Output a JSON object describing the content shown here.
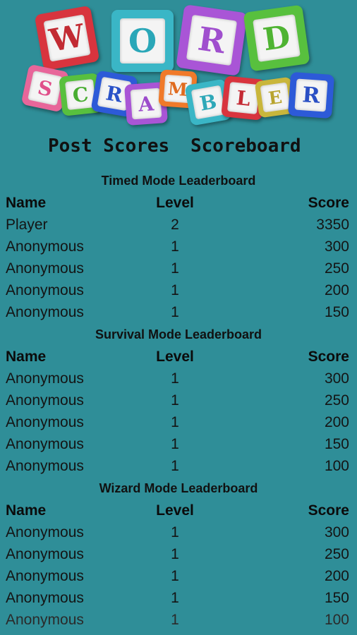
{
  "app": {
    "logo_word_top": [
      "W",
      "O",
      "R",
      "D"
    ],
    "logo_word_bottom": [
      "S",
      "C",
      "R",
      "A",
      "M",
      "B",
      "L",
      "E",
      "R"
    ]
  },
  "nav": {
    "post_scores": "Post Scores",
    "scoreboard": "Scoreboard"
  },
  "columns": {
    "name": "Name",
    "level": "Level",
    "score": "Score"
  },
  "boards": [
    {
      "title": "Timed Mode Leaderboard",
      "rows": [
        {
          "name": "Player",
          "level": "2",
          "score": "3350"
        },
        {
          "name": "Anonymous",
          "level": "1",
          "score": "300"
        },
        {
          "name": "Anonymous",
          "level": "1",
          "score": "250"
        },
        {
          "name": "Anonymous",
          "level": "1",
          "score": "200"
        },
        {
          "name": "Anonymous",
          "level": "1",
          "score": "150"
        }
      ]
    },
    {
      "title": "Survival Mode Leaderboard",
      "rows": [
        {
          "name": "Anonymous",
          "level": "1",
          "score": "300"
        },
        {
          "name": "Anonymous",
          "level": "1",
          "score": "250"
        },
        {
          "name": "Anonymous",
          "level": "1",
          "score": "200"
        },
        {
          "name": "Anonymous",
          "level": "1",
          "score": "150"
        },
        {
          "name": "Anonymous",
          "level": "1",
          "score": "100"
        }
      ]
    },
    {
      "title": "Wizard Mode Leaderboard",
      "rows": [
        {
          "name": "Anonymous",
          "level": "1",
          "score": "300"
        },
        {
          "name": "Anonymous",
          "level": "1",
          "score": "250"
        },
        {
          "name": "Anonymous",
          "level": "1",
          "score": "200"
        },
        {
          "name": "Anonymous",
          "level": "1",
          "score": "150"
        },
        {
          "name": "Anonymous",
          "level": "1",
          "score": "100"
        }
      ]
    }
  ],
  "colors": {
    "background": "#2f8e98",
    "tile_red": "#d8343e",
    "tile_teal": "#3ab6c6",
    "tile_purple": "#a955d6",
    "tile_green": "#58c03e",
    "tile_pink": "#e8669a",
    "tile_blue": "#2d5ad8",
    "tile_orange": "#f07a2a",
    "tile_olive": "#c9b63b"
  }
}
